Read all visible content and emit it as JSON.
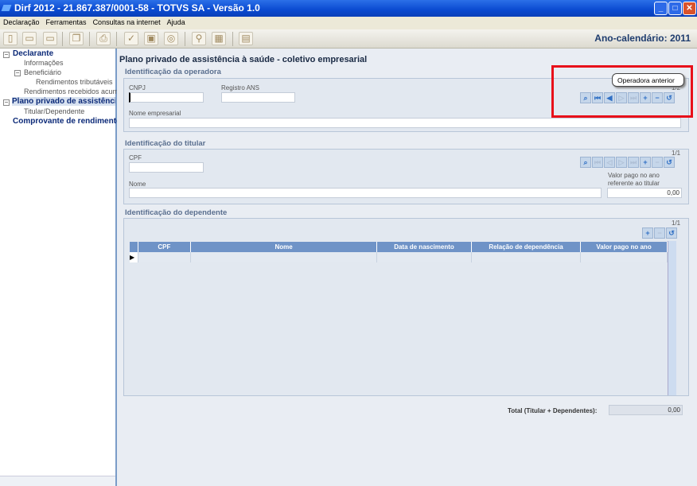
{
  "window": {
    "title": "Dirf 2012 - 21.867.387/0001-58 - TOTVS SA - Versão 1.0"
  },
  "menu": [
    "Declaração",
    "Ferramentas",
    "Consultas na internet",
    "Ajuda"
  ],
  "toolbar": {
    "year_label": "Ano-calendário: 2011"
  },
  "sidebar": {
    "items": [
      "Declarante",
      "Informações",
      "Beneficiário",
      "Rendimentos tributáveis",
      "Rendimentos recebidos acumula",
      "Plano privado de assistência à",
      "Titular/Dependente",
      "Comprovante de rendimentos"
    ]
  },
  "main": {
    "title": "Plano privado de assistência à saúde - coletivo empresarial",
    "operadora": {
      "header": "Identificação da operadora",
      "cnpj_label": "CNPJ",
      "cnpj": "",
      "ans_label": "Registro ANS",
      "ans": "",
      "nome_label": "Nome empresarial",
      "nome": "",
      "count": "1/2",
      "tooltip": "Operadora anterior"
    },
    "titular": {
      "header": "Identificação do titular",
      "cpf_label": "CPF",
      "cpf": "",
      "nome_label": "Nome",
      "nome": "",
      "valor_label_1": "Valor pago no ano",
      "valor_label_2": "referente ao titular",
      "valor": "0,00",
      "count": "1/1"
    },
    "dependente": {
      "header": "Identificação do dependente",
      "count": "1/1",
      "columns": [
        "CPF",
        "Nome",
        "Data de nascimento",
        "Relação de dependência",
        "Valor pago no ano"
      ]
    },
    "total": {
      "label": "Total (Titular + Dependentes):",
      "value": "0,00"
    }
  }
}
